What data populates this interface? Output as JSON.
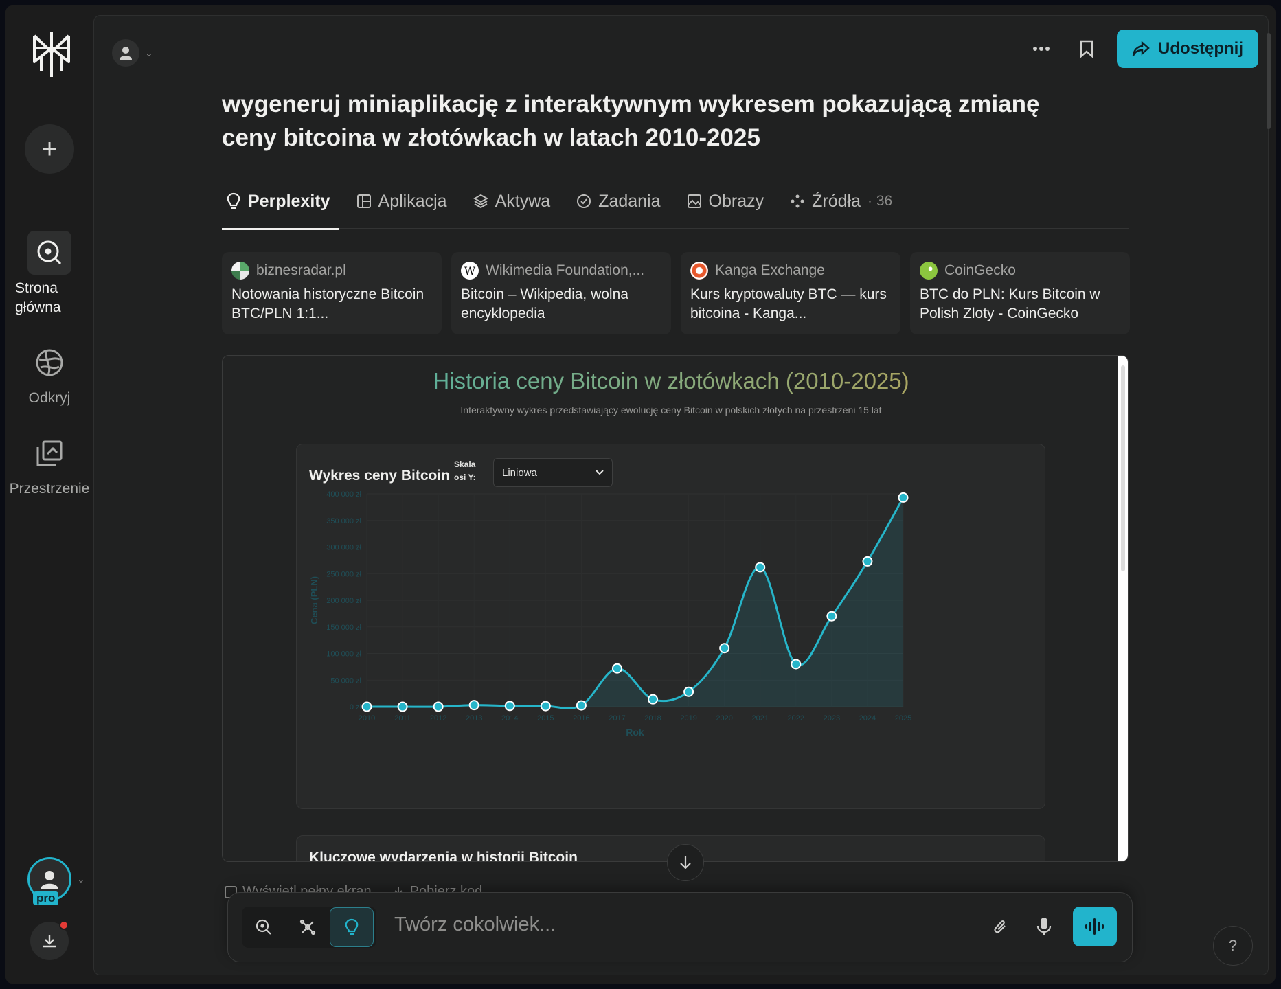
{
  "sidebar": {
    "nav": [
      {
        "label": "Strona\ngłówna"
      },
      {
        "label": "Odkryj"
      },
      {
        "label": "Przestrzenie"
      }
    ],
    "pro_badge": "pro"
  },
  "header": {
    "share_label": "Udostępnij"
  },
  "question": "wygeneruj miniaplikację z interaktywnym wykresem pokazującą zmianę ceny bitcoina w złotówkach w latach 2010-2025",
  "tabs": [
    {
      "label": "Perplexity"
    },
    {
      "label": "Aplikacja"
    },
    {
      "label": "Aktywa"
    },
    {
      "label": "Zadania"
    },
    {
      "label": "Obrazy"
    },
    {
      "label": "Źródła",
      "count": "· 36"
    }
  ],
  "sources": [
    {
      "site": "biznesradar.pl",
      "title": "Notowania historyczne Bitcoin BTC/PLN 1:1..."
    },
    {
      "site": "Wikimedia Foundation,...",
      "title": "Bitcoin – Wikipedia, wolna encyklopedia"
    },
    {
      "site": "Kanga Exchange",
      "title": "Kurs kryptowaluty BTC — kurs bitcoina - Kanga..."
    },
    {
      "site": "CoinGecko",
      "title": "BTC do PLN: Kurs Bitcoin w Polish Zloty - CoinGecko"
    }
  ],
  "app": {
    "title": "Historia ceny Bitcoin w złotówkach (2010-2025)",
    "subtitle": "Interaktywny wykres przedstawiający ewolucję ceny Bitcoin w polskich złotych na przestrzeni 15 lat",
    "chart_card_title": "Wykres ceny Bitcoin",
    "scale_label": "Skala osi Y:",
    "scale_value": "Liniowa",
    "events_title": "Kluczowe wydarzenia w historii Bitcoin"
  },
  "under_links": {
    "fullscreen": "Wyświetl pełny ekran",
    "download": "Pobierz kod"
  },
  "composer": {
    "placeholder": "Twórz cokolwiek..."
  },
  "help": "?",
  "colors": {
    "accent": "#22b4cc",
    "line": "#26b5c9"
  },
  "chart_data": {
    "type": "line",
    "xlabel": "Rok",
    "ylabel": "Cena (PLN)",
    "ylim": [
      0,
      400000
    ],
    "yticks": [
      "0 zł",
      "50 000 zł",
      "100 000 zł",
      "150 000 zł",
      "200 000 zł",
      "250 000 zł",
      "300 000 zł",
      "350 000 zł",
      "400 000 zł"
    ],
    "x": [
      "2010",
      "2011",
      "2012",
      "2013",
      "2014",
      "2015",
      "2016",
      "2017",
      "2018",
      "2019",
      "2020",
      "2021",
      "2022",
      "2023",
      "2024",
      "2025"
    ],
    "series": [
      {
        "values": [
          0,
          0,
          50,
          3000,
          1500,
          1200,
          2500,
          72000,
          14000,
          28000,
          110000,
          262000,
          80000,
          170000,
          273000,
          393000
        ]
      }
    ],
    "grid": true
  }
}
